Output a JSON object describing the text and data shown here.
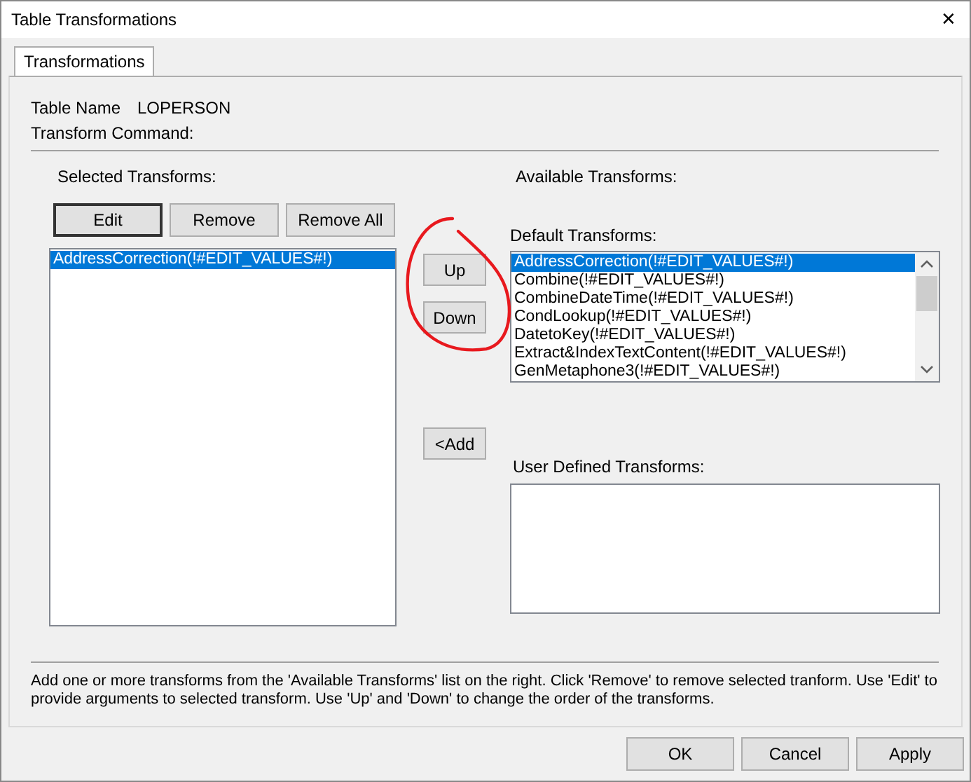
{
  "window": {
    "title": "Table Transformations",
    "close": "✕"
  },
  "tabs": [
    {
      "label": "Transformations",
      "selected": true
    }
  ],
  "table_name": {
    "label": "Table Name",
    "value": "LOPERSON"
  },
  "transform_command": {
    "label": "Transform Command:"
  },
  "selected_transforms": {
    "label": "Selected Transforms:",
    "buttons": [
      {
        "label": "Edit",
        "default": true
      },
      {
        "label": "Remove",
        "default": false
      },
      {
        "label": "Remove All",
        "default": false
      }
    ],
    "items": [
      {
        "text": "AddressCorrection(!#EDIT_VALUES#!)",
        "selected": true
      }
    ]
  },
  "move_buttons": [
    "Up",
    "Down"
  ],
  "add_button": "<Add",
  "available_transforms": {
    "label": "Available Transforms:"
  },
  "default_transforms": {
    "label": "Default Transforms:",
    "items": [
      {
        "text": "AddressCorrection(!#EDIT_VALUES#!)",
        "selected": true
      },
      {
        "text": "Combine(!#EDIT_VALUES#!)",
        "selected": false
      },
      {
        "text": "CombineDateTime(!#EDIT_VALUES#!)",
        "selected": false
      },
      {
        "text": "CondLookup(!#EDIT_VALUES#!)",
        "selected": false
      },
      {
        "text": "DatetoKey(!#EDIT_VALUES#!)",
        "selected": false
      },
      {
        "text": "Extract&IndexTextContent(!#EDIT_VALUES#!)",
        "selected": false
      },
      {
        "text": "GenMetaphone3(!#EDIT_VALUES#!)",
        "selected": false
      }
    ]
  },
  "user_defined_transforms": {
    "label": "User Defined Transforms:"
  },
  "help_text": "Add one or more transforms from the 'Available Transforms' list on the right. Click 'Remove' to remove selected tranform. Use 'Edit' to provide arguments to selected transform. Use 'Up' and 'Down' to change the order of the transforms.",
  "dialog_buttons": [
    "OK",
    "Cancel",
    "Apply"
  ]
}
